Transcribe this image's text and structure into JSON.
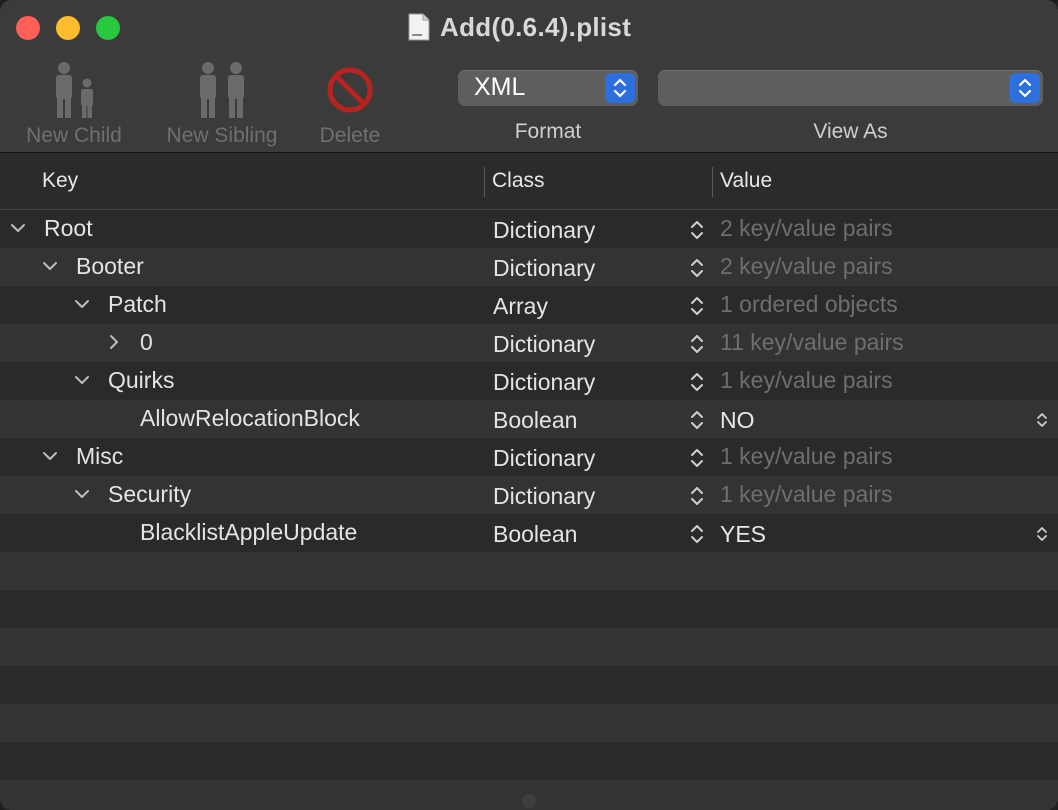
{
  "window": {
    "title": "Add(0.6.4).plist"
  },
  "toolbar": {
    "new_child": "New Child",
    "new_sibling": "New Sibling",
    "delete": "Delete",
    "format_value": "XML",
    "format_label": "Format",
    "view_as_value": "",
    "view_as_label": "View As"
  },
  "table": {
    "headers": {
      "key": "Key",
      "class": "Class",
      "value": "Value"
    },
    "rows": [
      {
        "key": "Root",
        "class": "Dictionary",
        "value": "2 key/value pairs",
        "disclosure": "expanded"
      },
      {
        "key": "Booter",
        "class": "Dictionary",
        "value": "2 key/value pairs",
        "disclosure": "expanded"
      },
      {
        "key": "Patch",
        "class": "Array",
        "value": "1 ordered objects",
        "disclosure": "expanded"
      },
      {
        "key": "0",
        "class": "Dictionary",
        "value": "11 key/value pairs",
        "disclosure": "collapsed"
      },
      {
        "key": "Quirks",
        "class": "Dictionary",
        "value": "1 key/value pairs",
        "disclosure": "expanded"
      },
      {
        "key": "AllowRelocationBlock",
        "class": "Boolean",
        "value": "NO",
        "disclosure": "none"
      },
      {
        "key": "Misc",
        "class": "Dictionary",
        "value": "1 key/value pairs",
        "disclosure": "expanded"
      },
      {
        "key": "Security",
        "class": "Dictionary",
        "value": "1 key/value pairs",
        "disclosure": "expanded"
      },
      {
        "key": "BlacklistAppleUpdate",
        "class": "Boolean",
        "value": "YES",
        "disclosure": "none"
      }
    ]
  },
  "colors": {
    "accent": "#2e6fe0",
    "close": "#fe5f57",
    "minimize": "#febc2e",
    "maximize": "#28c840",
    "delete_icon": "#c62828"
  },
  "icons": {
    "new_child": "parent-child-icon",
    "new_sibling": "siblings-icon",
    "delete": "prohibited-icon",
    "document": "plist-file-icon"
  }
}
